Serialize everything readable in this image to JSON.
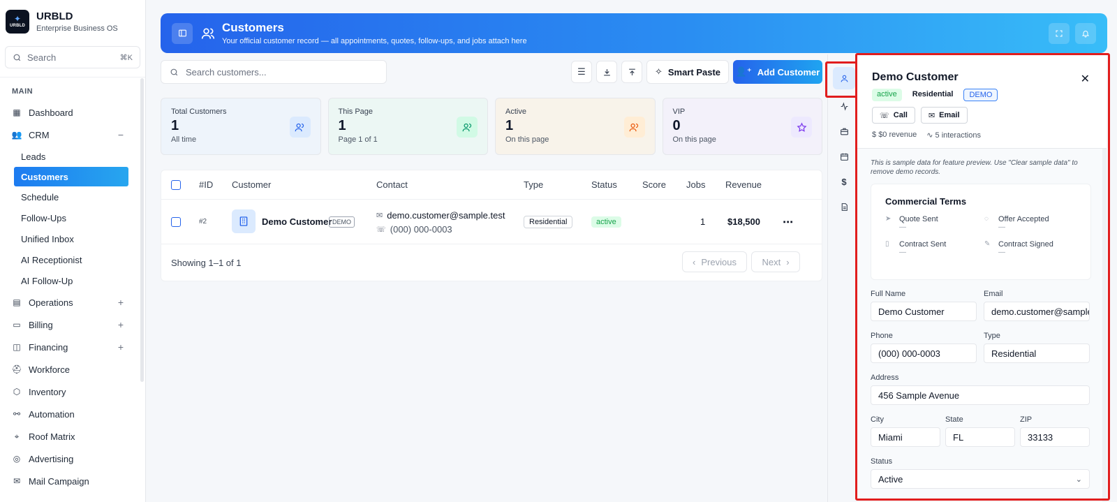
{
  "brand": {
    "name": "URBLD",
    "subtitle": "Enterprise Business OS",
    "logo_text": "URBLD"
  },
  "sidebar": {
    "search_placeholder": "Search",
    "search_shortcut": "⌘K",
    "section_main": "MAIN",
    "items": [
      {
        "label": "Dashboard",
        "icon": "grid-icon"
      },
      {
        "label": "CRM",
        "icon": "users-icon",
        "tail": "−"
      },
      {
        "label": "Operations",
        "icon": "briefcase-icon",
        "tail": "+"
      },
      {
        "label": "Billing",
        "icon": "card-icon",
        "tail": "+"
      },
      {
        "label": "Financing",
        "icon": "wallet-icon",
        "tail": "+"
      },
      {
        "label": "Workforce",
        "icon": "helmet-icon"
      },
      {
        "label": "Inventory",
        "icon": "box-icon"
      },
      {
        "label": "Automation",
        "icon": "workflow-icon"
      },
      {
        "label": "Roof Matrix",
        "icon": "pin-icon"
      },
      {
        "label": "Advertising",
        "icon": "target-icon"
      },
      {
        "label": "Mail Campaign",
        "icon": "mail-icon"
      }
    ],
    "crm_sub": [
      "Leads",
      "Customers",
      "Schedule",
      "Follow-Ups",
      "Unified Inbox",
      "AI Receptionist",
      "AI Follow-Up"
    ],
    "active_sub": "Customers"
  },
  "header": {
    "title": "Customers",
    "subtitle": "Your official customer record — all appointments, quotes, follow-ups, and jobs attach here"
  },
  "toolbar": {
    "search_placeholder": "Search customers...",
    "smart_paste": "Smart Paste",
    "add_customer": "Add Customer"
  },
  "stats": [
    {
      "label": "Total Customers",
      "value": "1",
      "caption": "All time",
      "bg": "#eef4fb",
      "icon_bg": "#dbeafe",
      "icon_color": "#2563eb",
      "icon": "users-icon"
    },
    {
      "label": "This Page",
      "value": "1",
      "caption": "Page 1 of 1",
      "bg": "#ecf7f4",
      "icon_bg": "#d1fae5",
      "icon_color": "#059669",
      "icon": "users-icon"
    },
    {
      "label": "Active",
      "value": "1",
      "caption": "On this page",
      "bg": "#f8f3ea",
      "icon_bg": "#ffedd5",
      "icon_color": "#ea580c",
      "icon": "users-icon"
    },
    {
      "label": "VIP",
      "value": "0",
      "caption": "On this page",
      "bg": "#f3f1fa",
      "icon_bg": "#ede9fe",
      "icon_color": "#7c3aed",
      "icon": "star-icon"
    }
  ],
  "table": {
    "columns": [
      "#ID",
      "Customer",
      "Contact",
      "Type",
      "Status",
      "Score",
      "Jobs",
      "Revenue"
    ],
    "rows": [
      {
        "id": "#2",
        "name": "Demo Customer",
        "demo": "DEMO",
        "email": "demo.customer@sample.test",
        "phone": "(000) 000-0003",
        "type": "Residential",
        "status": "active",
        "score": "",
        "jobs": "1",
        "revenue": "$18,500"
      }
    ],
    "footer": "Showing 1–1 of 1",
    "prev": "Previous",
    "next": "Next"
  },
  "panel": {
    "title": "Demo Customer",
    "badges": {
      "status": "active",
      "type": "Residential",
      "demo": "DEMO"
    },
    "call": "Call",
    "email_btn": "Email",
    "revenue": "$0 revenue",
    "interactions": "5 interactions",
    "note": "This is sample data for feature preview. Use \"Clear sample data\" to remove demo records.",
    "terms_title": "Commercial Terms",
    "terms": [
      {
        "label": "Quote Sent",
        "value": "—"
      },
      {
        "label": "Offer Accepted",
        "value": "—"
      },
      {
        "label": "Contract Sent",
        "value": "—"
      },
      {
        "label": "Contract Signed",
        "value": "—"
      }
    ],
    "fields": {
      "full_name_label": "Full Name",
      "full_name": "Demo Customer",
      "email_label": "Email",
      "email": "demo.customer@sample.test",
      "phone_label": "Phone",
      "phone": "(000) 000-0003",
      "type_label": "Type",
      "type": "Residential",
      "address_label": "Address",
      "address": "456 Sample Avenue",
      "city_label": "City",
      "city": "Miami",
      "state_label": "State",
      "state": "FL",
      "zip_label": "ZIP",
      "zip": "33133",
      "status_label": "Status",
      "status": "Active"
    }
  },
  "colors": {
    "accent": "#2563eb",
    "highlight": "#e11d1d"
  }
}
